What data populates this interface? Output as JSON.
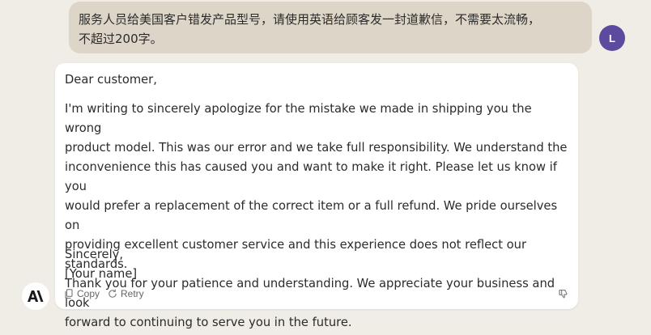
{
  "user_message": {
    "text": "服务人员给美国客户错发产品型号，请使用英语给顾客发一封道歉信，不需要太流畅，\n不超过200字。",
    "avatar_initial": "L",
    "avatar_color": "#5c4a9e"
  },
  "assistant_message": {
    "greeting": "Dear customer,",
    "body": "I'm writing to sincerely apologize for the mistake we made in shipping you the wrong\nproduct model. This was our error and we take full responsibility. We understand the\ninconvenience this has caused you and want to make it right. Please let us know if you\nwould prefer a replacement of the correct item or a full refund. We pride ourselves on\nproviding excellent customer service and this experience does not reflect our standards.\nThank you for your patience and understanding. We appreciate your business and look\nforward to continuing to serve you in the future.",
    "closing": "Sincerely,\n[Your name]",
    "actions": {
      "copy_label": "Copy",
      "retry_label": "Retry"
    },
    "icons": {
      "copy": "copy-icon",
      "retry": "retry-icon",
      "thumbs_down": "thumbs-down-icon",
      "assistant_logo": "anthropic-logo-icon"
    }
  },
  "colors": {
    "page_background": "#f0ede7",
    "user_bubble": "#ddd5c8",
    "assistant_card": "#ffffff",
    "text": "#2b2b2b",
    "muted_text": "#666666"
  }
}
